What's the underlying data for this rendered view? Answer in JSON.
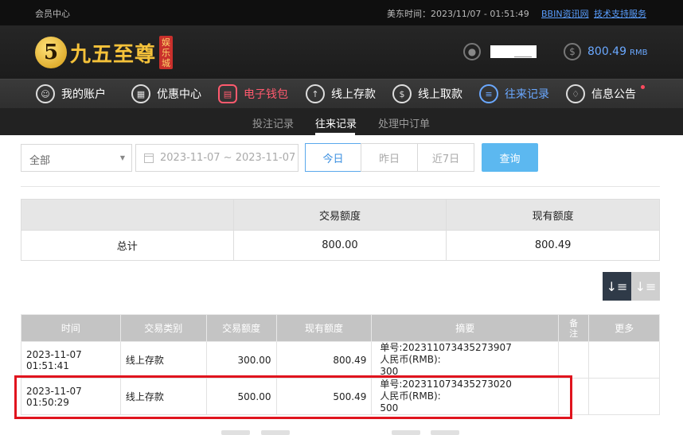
{
  "topbar": {
    "member_center": "会员中心",
    "time_label": "美东时间：2023/11/07 - 01:51:49",
    "bbin_link": "BBIN资讯网",
    "support_link": "技术支持服务"
  },
  "header": {
    "logo_mark": "5",
    "logo_text": "九五至尊",
    "logo_badge": [
      "娱",
      "乐",
      "城"
    ],
    "balance_amount": "800.49",
    "balance_currency": "RMB"
  },
  "nav": {
    "items": [
      {
        "label": "我的账户",
        "icon": "user-icon"
      },
      {
        "label": "优惠中心",
        "icon": "gift-icon"
      },
      {
        "label": "电子钱包",
        "icon": "wallet-icon"
      },
      {
        "label": "线上存款",
        "icon": "deposit-icon"
      },
      {
        "label": "线上取款",
        "icon": "withdraw-icon"
      },
      {
        "label": "往来记录",
        "icon": "records-icon"
      },
      {
        "label": "信息公告",
        "icon": "bell-icon"
      }
    ]
  },
  "subnav": {
    "tabs": [
      "投注记录",
      "往来记录",
      "处理中订单"
    ]
  },
  "filter": {
    "type_selected": "全部",
    "date_range": "2023-11-07 ~ 2023-11-07",
    "range_buttons": [
      "今日",
      "昨日",
      "近7日"
    ],
    "query_label": "查询"
  },
  "summary": {
    "headers": [
      "",
      "交易额度",
      "现有额度"
    ],
    "row": [
      "总计",
      "800.00",
      "800.49"
    ]
  },
  "records": {
    "headers": [
      "时间",
      "交易类别",
      "交易额度",
      "现有额度",
      "摘要",
      "备注",
      "更多"
    ],
    "rows": [
      {
        "time": "2023-11-07 01:51:41",
        "type": "线上存款",
        "amount": "300.00",
        "balance": "800.49",
        "memo_order": "单号:202311073435273907",
        "memo_currency": "人民币(RMB):",
        "memo_value": "300",
        "note": "",
        "more": ""
      },
      {
        "time": "2023-11-07 01:50:29",
        "type": "线上存款",
        "amount": "500.00",
        "balance": "500.49",
        "memo_order": "单号:202311073435273020",
        "memo_currency": "人民币(RMB):",
        "memo_value": "500",
        "note": "",
        "more": ""
      }
    ]
  },
  "colors": {
    "accent_blue": "#5cb8f0",
    "active_red": "#ff5a6e",
    "highlight_red": "#e0141e",
    "gold": "#f5c23a"
  }
}
